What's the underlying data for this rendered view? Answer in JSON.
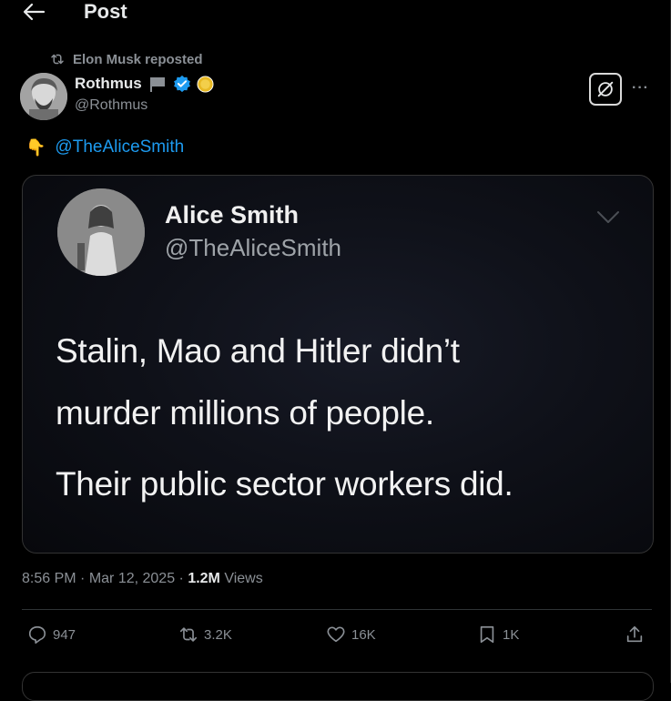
{
  "header": {
    "title": "Post"
  },
  "repost": {
    "text": "Elon Musk reposted"
  },
  "author": {
    "name": "Rothmus",
    "handle": "@Rothmus"
  },
  "tweet": {
    "emoji": "👇",
    "mention": "@TheAliceSmith"
  },
  "media": {
    "name": "Alice Smith",
    "handle": "@TheAliceSmith",
    "line1": "Stalin, Mao and Hitler didn’t",
    "line2": "murder millions of people.",
    "line3": "Their public sector workers did."
  },
  "meta": {
    "time": "8:56 PM",
    "sep1": " · ",
    "date": "Mar 12, 2025",
    "sep2": " · ",
    "views_count": "1.2M",
    "views_label": " Views"
  },
  "actions": {
    "replies": "947",
    "reposts": "3.2K",
    "likes": "16K",
    "bookmarks": "1K"
  },
  "icons": [
    "back-arrow-icon",
    "repost-icon",
    "flag-icon",
    "verified-badge-icon",
    "gold-coin-icon",
    "grok-icon",
    "more-icon",
    "pointing-down-emoji",
    "chevron-down-icon",
    "reply-icon",
    "like-icon",
    "bookmark-icon",
    "share-icon"
  ],
  "colors": {
    "accent": "#1d9bf0",
    "text": "#e7e9ea",
    "muted": "#8b9096",
    "background": "#000000"
  }
}
